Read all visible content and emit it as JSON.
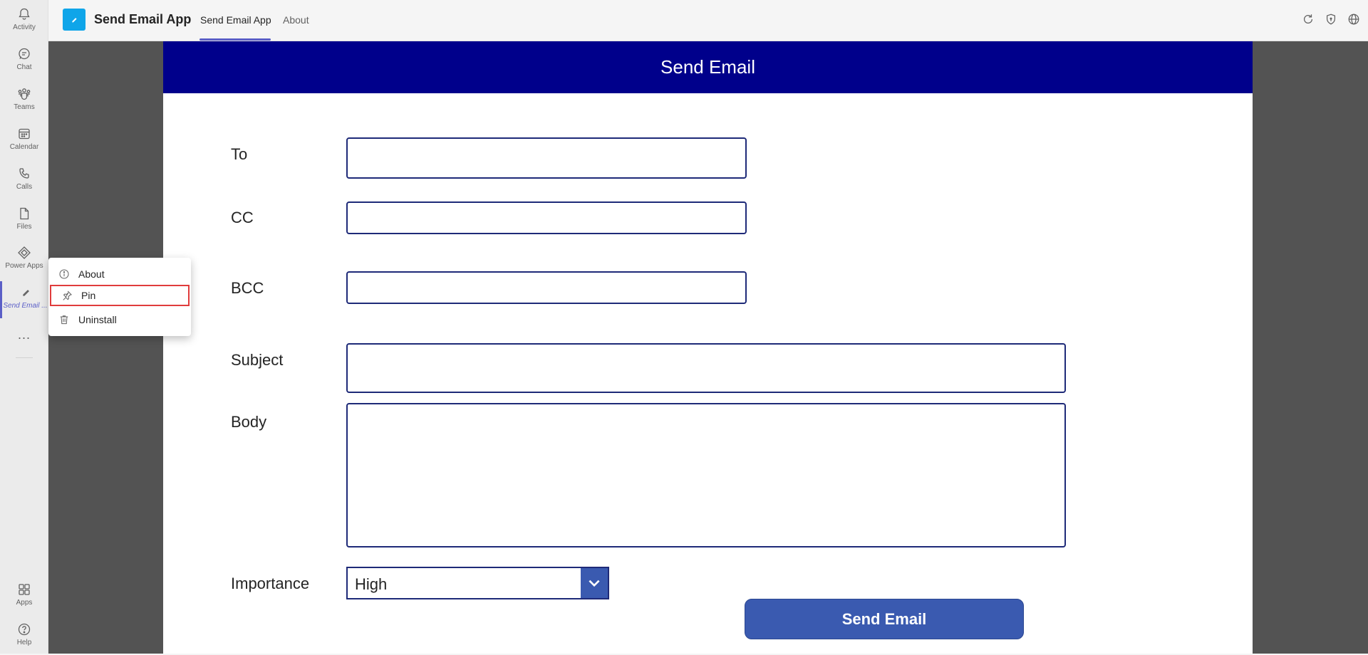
{
  "rail": {
    "items": [
      {
        "label": "Activity",
        "icon": "bell-icon"
      },
      {
        "label": "Chat",
        "icon": "chat-icon"
      },
      {
        "label": "Teams",
        "icon": "teams-icon"
      },
      {
        "label": "Calendar",
        "icon": "calendar-icon"
      },
      {
        "label": "Calls",
        "icon": "phone-icon"
      },
      {
        "label": "Files",
        "icon": "file-icon"
      },
      {
        "label": "Power Apps",
        "icon": "power-apps-icon"
      },
      {
        "label": "Send Email ...",
        "icon": "pencil-icon"
      }
    ],
    "more": "...",
    "bottom": [
      {
        "label": "Apps",
        "icon": "apps-icon"
      },
      {
        "label": "Help",
        "icon": "help-icon"
      }
    ]
  },
  "topbar": {
    "app_name": "Send Email App",
    "tabs": [
      {
        "label": "Send Email App"
      },
      {
        "label": "About"
      }
    ],
    "icons": [
      "refresh-icon",
      "shield-icon",
      "globe-icon"
    ]
  },
  "context_menu": {
    "items": [
      {
        "label": "About",
        "icon": "info-icon"
      },
      {
        "label": "Pin",
        "icon": "pin-icon"
      },
      {
        "label": "Uninstall",
        "icon": "trash-icon"
      }
    ],
    "highlighted": "Pin"
  },
  "form": {
    "banner_title": "Send Email",
    "labels": {
      "to": "To",
      "cc": "CC",
      "bcc": "BCC",
      "subject": "Subject",
      "body": "Body",
      "importance": "Importance"
    },
    "values": {
      "to": "",
      "cc": "",
      "bcc": "",
      "subject": "",
      "body": ""
    },
    "importance_value": "High",
    "send_label": "Send Email"
  },
  "colors": {
    "banner": "#00008b",
    "button": "#3a5ab0",
    "accent": "#5b5fc7",
    "highlight_border": "#e03c3c"
  }
}
